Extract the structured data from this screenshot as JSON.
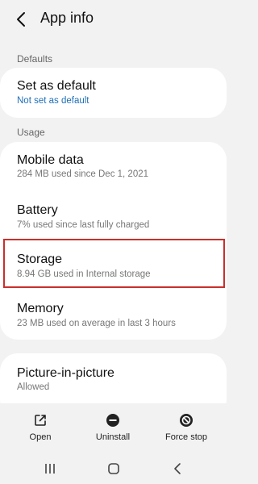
{
  "header": {
    "title": "App info"
  },
  "sections": {
    "defaults_label": "Defaults",
    "usage_label": "Usage"
  },
  "defaults": {
    "set_as_default": {
      "title": "Set as default",
      "sub": "Not set as default"
    }
  },
  "usage": {
    "mobile_data": {
      "title": "Mobile data",
      "sub": "284 MB used since Dec 1, 2021"
    },
    "battery": {
      "title": "Battery",
      "sub": "7% used since last fully charged"
    },
    "storage": {
      "title": "Storage",
      "sub": "8.94 GB used in Internal storage"
    },
    "memory": {
      "title": "Memory",
      "sub": "23 MB used on average in last 3 hours"
    }
  },
  "pip": {
    "title": "Picture-in-picture",
    "sub": "Allowed"
  },
  "actions": {
    "open": "Open",
    "uninstall": "Uninstall",
    "force_stop": "Force stop"
  },
  "colors": {
    "link": "#1f6fb8",
    "highlight": "#c9302c",
    "background": "#f2f2f2"
  },
  "icons": {
    "back": "chevron-left-icon",
    "open": "open-external-icon",
    "uninstall": "minus-circle-icon",
    "force_stop": "block-circle-icon",
    "nav_recents": "recents-icon",
    "nav_home": "home-icon",
    "nav_back": "nav-back-icon"
  }
}
